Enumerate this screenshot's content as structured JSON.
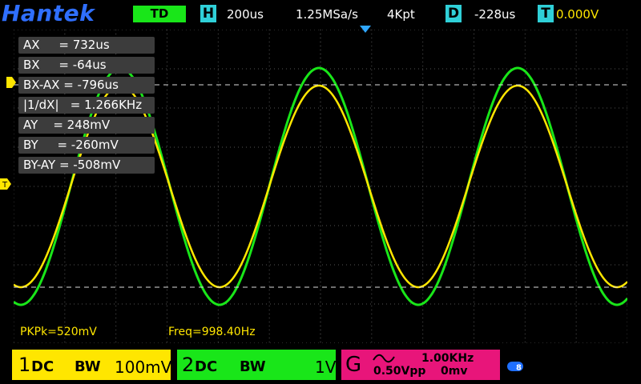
{
  "header": {
    "brand": "Hantek",
    "trigger_mode": "TD",
    "timebase_icon": "H",
    "timebase": "200us",
    "sample_rate": "1.25MSa/s",
    "memory_depth": "4Kpt",
    "delay_icon": "D",
    "delay": "-228us",
    "trigger_icon": "T",
    "trigger_level": "0.000V"
  },
  "measurements": [
    {
      "label": "AX     = 732us"
    },
    {
      "label": "BX     = -64us"
    },
    {
      "label": "BX-AX = -796us"
    },
    {
      "label": "|1/dX|   = 1.266KHz"
    },
    {
      "label": "AY    = 248mV"
    },
    {
      "label": "BY     = -260mV"
    },
    {
      "label": "BY-AY = -508mV"
    }
  ],
  "readouts": {
    "pkpk": "PKPk=520mV",
    "freq": "Freq=998.40Hz"
  },
  "channels": {
    "ch1": {
      "num": "1",
      "coupling": "DC",
      "bw": "BW",
      "scale": "100mV",
      "color": "#ffe600"
    },
    "ch2": {
      "num": "2",
      "coupling": "DC",
      "bw": "BW",
      "scale": "1V",
      "color": "#19e619"
    }
  },
  "generator": {
    "label": "G",
    "frequency": "1.00KHz",
    "amplitude": "0.50Vpp",
    "offset": "0mv",
    "color": "#e8157a"
  },
  "markers": {
    "trigger_marker": "T",
    "ch_marker_left": "1"
  },
  "icons": {
    "usb": "usb-icon",
    "trigger_pos": "trigger-position-icon",
    "sine": "sine-wave-icon"
  }
}
